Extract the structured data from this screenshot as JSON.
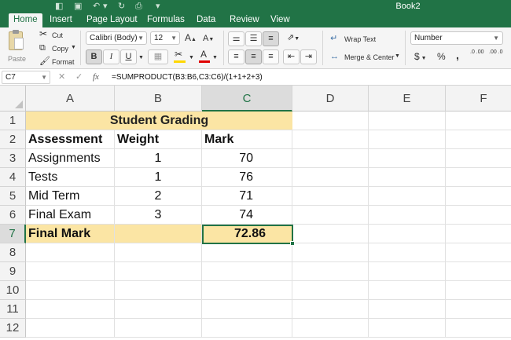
{
  "window": {
    "title": "Book2",
    "icons": [
      "sidebar-icon",
      "save-icon",
      "undo-icon",
      "redo-icon",
      "print-icon",
      "customize-icon"
    ]
  },
  "tabs": [
    {
      "label": "Home",
      "active": true
    },
    {
      "label": "Insert",
      "active": false
    },
    {
      "label": "Page Layout",
      "active": false
    },
    {
      "label": "Formulas",
      "active": false
    },
    {
      "label": "Data",
      "active": false
    },
    {
      "label": "Review",
      "active": false
    },
    {
      "label": "View",
      "active": false
    }
  ],
  "ribbon": {
    "paste_label": "Paste",
    "cut_label": "Cut",
    "copy_label": "Copy",
    "format_label": "Format",
    "font_name": "Calibri (Body)",
    "font_size": "12",
    "grow_font": "A",
    "shrink_font": "A",
    "bold": "B",
    "italic": "I",
    "underline": "U",
    "font_color_letter": "A",
    "wrap_text_label": "Wrap Text",
    "merge_center_label": "Merge & Center",
    "number_format": "Number",
    "currency_symbol": "$",
    "percent_symbol": "%",
    "comma_symbol": ",",
    "increase_decimal": ".0 .00",
    "decrease_decimal": ".00 .0",
    "accent_color": "#217346",
    "font_color_bar": "#e00000",
    "fill_color_bar": "#ffd700"
  },
  "formula_bar": {
    "cell_ref": "C7",
    "formula": "=SUMPRODUCT(B3:B6,C3:C6)/(1+1+2+3)",
    "fx_label": "fx"
  },
  "sheet": {
    "columns": [
      "A",
      "B",
      "C",
      "D",
      "E",
      "F"
    ],
    "selected_column": "C",
    "rows": [
      "1",
      "2",
      "3",
      "4",
      "5",
      "6",
      "7",
      "8",
      "9",
      "10",
      "11",
      "12"
    ],
    "selected_row": "7",
    "title": "Student Grading",
    "headers": [
      "Assessment",
      "Weight",
      "Mark"
    ],
    "records": [
      {
        "assessment": "Assignments",
        "weight": "1",
        "mark": "70"
      },
      {
        "assessment": "Tests",
        "weight": "1",
        "mark": "76"
      },
      {
        "assessment": "Mid Term",
        "weight": "2",
        "mark": "71"
      },
      {
        "assessment": "Final Exam",
        "weight": "3",
        "mark": "74"
      }
    ],
    "final_label": "Final Mark",
    "final_value": "72.86",
    "highlight_color": "#fbe5a4"
  }
}
